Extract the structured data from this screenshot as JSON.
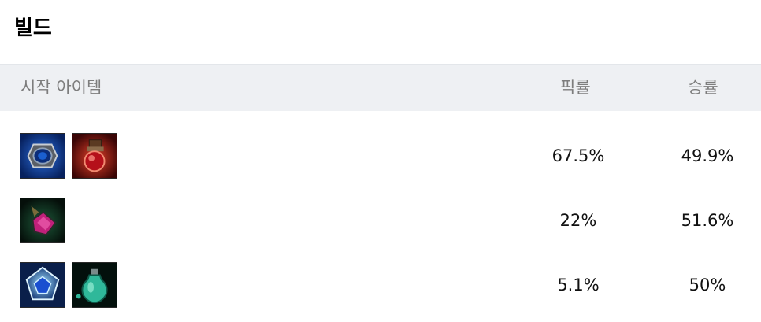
{
  "title": "빌드",
  "header": {
    "items_label": "시작 아이템",
    "pick_label": "픽률",
    "win_label": "승률"
  },
  "rows": [
    {
      "items": [
        "ring-item-icon",
        "health-potion-bag-item-icon"
      ],
      "pick_rate": "67.5%",
      "win_rate": "49.9%"
    },
    {
      "items": [
        "corrupting-potion-item-icon"
      ],
      "pick_rate": "22%",
      "win_rate": "51.6%"
    },
    {
      "items": [
        "blue-crystal-item-icon",
        "refillable-potion-item-icon"
      ],
      "pick_rate": "5.1%",
      "win_rate": "50%"
    }
  ]
}
